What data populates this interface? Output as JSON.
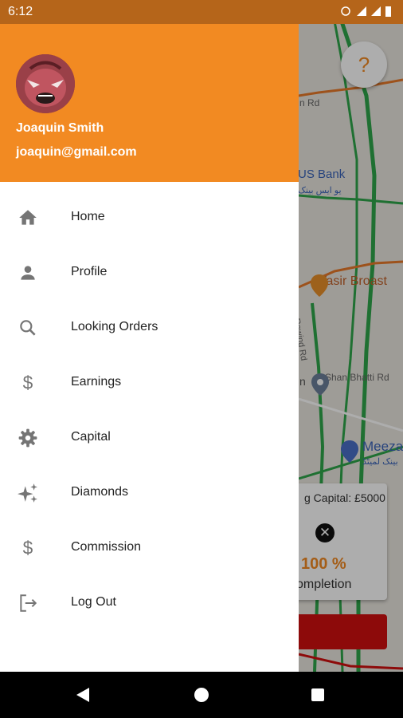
{
  "status_bar": {
    "time": "6:12"
  },
  "drawer": {
    "header": {
      "name": "Joaquin Smith",
      "email": "joaquin@gmail.com",
      "color": "#f28a22"
    },
    "items": [
      {
        "label": "Home",
        "icon": "home-icon"
      },
      {
        "label": "Profile",
        "icon": "person-icon"
      },
      {
        "label": "Looking Orders",
        "icon": "search-icon"
      },
      {
        "label": "Earnings",
        "icon": "dollar-icon"
      },
      {
        "label": "Capital",
        "icon": "gear-icon"
      },
      {
        "label": "Diamonds",
        "icon": "sparkle-icon"
      },
      {
        "label": "Commission",
        "icon": "dollar-icon"
      },
      {
        "label": "Log Out",
        "icon": "logout-icon"
      }
    ]
  },
  "map": {
    "labels": [
      "n Rd",
      "US Bank",
      "یو ایس بینک",
      "Yasir Broast",
      "Rawind Rd",
      "Shan Bhatti Rd",
      "n",
      "Meeza",
      "بینک لمیٹڈ"
    ],
    "help_button": "?",
    "card": {
      "capital_label": "g Capital: £5000",
      "close": "✕",
      "percentage": "100 %",
      "completion_label": "ompletion"
    }
  }
}
